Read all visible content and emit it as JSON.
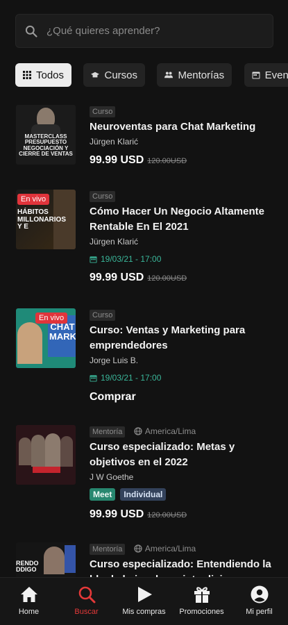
{
  "search": {
    "placeholder": "¿Qué quieres aprender?"
  },
  "filters": [
    {
      "label": "Todos",
      "icon": "grid-icon",
      "active": true
    },
    {
      "label": "Cursos",
      "icon": "cap-icon",
      "active": false
    },
    {
      "label": "Mentorías",
      "icon": "people-icon",
      "active": false
    },
    {
      "label": "Even",
      "icon": "calendar-icon",
      "active": false
    }
  ],
  "items": [
    {
      "tag": "Curso",
      "title": "Neuroventas para Chat Marketing",
      "author": "Jürgen Klarić",
      "price": "99.99 USD",
      "old_price": "120.00USD",
      "thumb_text": "MASTERCLASS PRESUPUESTO NEGOCIACIÓN Y CIERRE DE VENTAS"
    },
    {
      "tag": "Curso",
      "live": "En vivo",
      "title": "Cómo Hacer Un Negocio Altamente Rentable En El 2021",
      "author": "Jürgen Klarić",
      "date": "19/03/21 - 17:00",
      "price": "99.99 USD",
      "old_price": "120.00USD",
      "thumb_text": "HÁBITOS MILLONARIOS Y E"
    },
    {
      "tag": "Curso",
      "live": "En vivo",
      "title": "Curso: Ventas y Marketing para emprendedores",
      "author": "Jorge Luis B.",
      "date": "19/03/21 - 17:00",
      "cta": "Comprar",
      "thumb_text": "CHAT MARKE"
    },
    {
      "tag": "Mentoría",
      "timezone": "America/Lima",
      "title": "Curso especializado: Metas y objetivos en el 2022",
      "author": "J W Goethe",
      "badges": [
        "Meet",
        "Individual"
      ],
      "price": "99.99 USD",
      "old_price": "120.00USD"
    },
    {
      "tag": "Mentoría",
      "timezone": "America/Lima",
      "title": "Curso especializado: Entendiendo la blockchain y las cripto divisas",
      "thumb_text": "RENDO DDIGO"
    }
  ],
  "nav": [
    {
      "label": "Home",
      "icon": "home-icon"
    },
    {
      "label": "Buscar",
      "icon": "search-icon",
      "active": true
    },
    {
      "label": "Mis compras",
      "icon": "play-icon"
    },
    {
      "label": "Promociones",
      "icon": "gift-icon"
    },
    {
      "label": "Mi perfil",
      "icon": "profile-icon"
    }
  ],
  "colors": {
    "accent": "#e53939",
    "live": "#e0343b",
    "date": "#3ab79a",
    "meet": "#27876f",
    "individual": "#33425b"
  }
}
